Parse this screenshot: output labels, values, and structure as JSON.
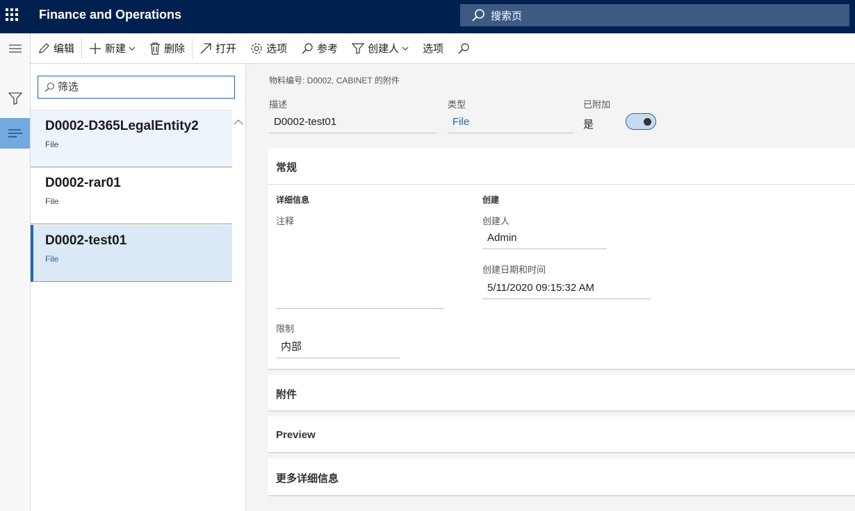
{
  "app": {
    "title": "Finance and Operations"
  },
  "search": {
    "placeholder": "搜索页"
  },
  "rail": {
    "items": [
      "hamburger-icon",
      "filter-icon",
      "list-icon"
    ]
  },
  "actions": {
    "edit": "编辑",
    "new": "新建",
    "delete": "删除",
    "open": "打开",
    "options": "选项",
    "reference": "参考",
    "creator": "创建人",
    "options2": "选项"
  },
  "list": {
    "filter_placeholder": "筛选",
    "items": [
      {
        "title": "D0002-D365LegalEntity2",
        "subtitle": "File"
      },
      {
        "title": "D0002-rar01",
        "subtitle": "File"
      },
      {
        "title": "D0002-test01",
        "subtitle": "File"
      }
    ]
  },
  "details": {
    "caption": "物料编号: D0002, CABINET 的附件",
    "description": {
      "label": "描述",
      "value": "D0002-test01"
    },
    "type": {
      "label": "类型",
      "value": "File"
    },
    "attached": {
      "label": "已附加",
      "value": "是",
      "toggle_on": true
    },
    "general": {
      "header": "常规",
      "details_header": "详细信息",
      "notes_label": "注释",
      "notes_value": "",
      "restriction_label": "限制",
      "restriction_value": "内部",
      "created_header": "创建",
      "created_by_label": "创建人",
      "created_by_value": "Admin",
      "created_dt_label": "创建日期和时间",
      "created_dt_value": "5/11/2020 09:15:32 AM"
    },
    "attachments_header": "附件",
    "preview_header": "Preview",
    "more_details_header": "更多详细信息"
  },
  "colors": {
    "navbar": "#002050",
    "accent": "#2266b0",
    "rail_active": "#71a9e0"
  }
}
